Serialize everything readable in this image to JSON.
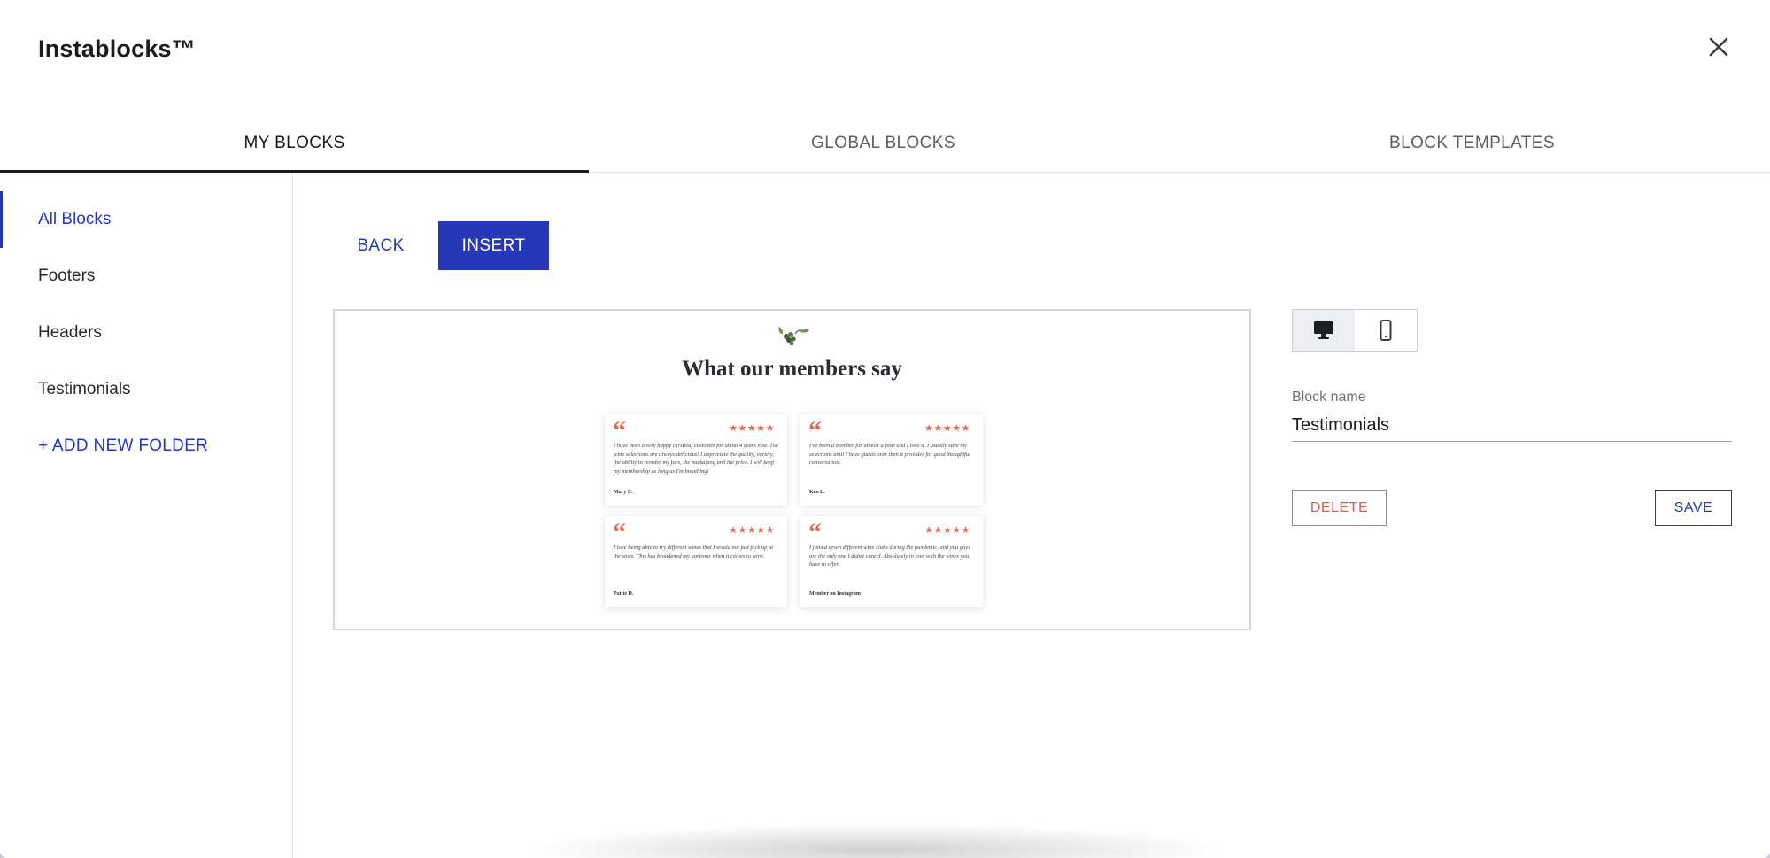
{
  "modal": {
    "title": "Instablocks™",
    "close_icon": "close-icon"
  },
  "tabs": [
    {
      "label": "MY BLOCKS",
      "active": true
    },
    {
      "label": "GLOBAL BLOCKS",
      "active": false
    },
    {
      "label": "BLOCK TEMPLATES",
      "active": false
    }
  ],
  "sidebar": {
    "items": [
      {
        "label": "All Blocks",
        "active": true
      },
      {
        "label": "Footers",
        "active": false
      },
      {
        "label": "Headers",
        "active": false
      },
      {
        "label": "Testimonials",
        "active": false
      }
    ],
    "add_folder": "+ ADD NEW FOLDER"
  },
  "toolbar": {
    "back_label": "BACK",
    "insert_label": "INSERT"
  },
  "preview": {
    "logo_icon": "grape-vine-icon",
    "heading": "What our members say",
    "cards": [
      {
        "quote": "“",
        "stars": "★★★★★",
        "text": "I have been a very happy Firstleaf customer for about 4 years now. The wine selections are always delicious! I appreciate the quality, variety, the ability to reorder my favs, the packaging and the price. I will keep my membership as long as I'm breathing!",
        "author": "Mary C."
      },
      {
        "quote": "“",
        "stars": "★★★★★",
        "text": "I've been a member for almost a year and I love it. I usually save my selections until I have guests over then it provides for good thoughtful conversation.",
        "author": "Ken L."
      },
      {
        "quote": "“",
        "stars": "★★★★★",
        "text": "I love being able to try different wines that I would not just pick up at the store. This has broadened my horizons when it comes to wine.",
        "author": "Pattie D."
      },
      {
        "quote": "“",
        "stars": "★★★★★",
        "text": "I joined seven different wine clubs during the pandemic, and you guys are the only one I didn't cancel. Absolutely in love with the wines you have to offer.",
        "author": "Member on Instagram"
      }
    ]
  },
  "device_toggle": {
    "desktop_icon": "desktop-icon",
    "mobile_icon": "mobile-icon",
    "selected": "desktop"
  },
  "block_form": {
    "name_label": "Block name",
    "name_value": "Testimonials",
    "delete_label": "DELETE",
    "save_label": "SAVE"
  },
  "colors": {
    "accent": "#2638b8",
    "danger": "#e0584c",
    "quote": "#e06a52"
  }
}
